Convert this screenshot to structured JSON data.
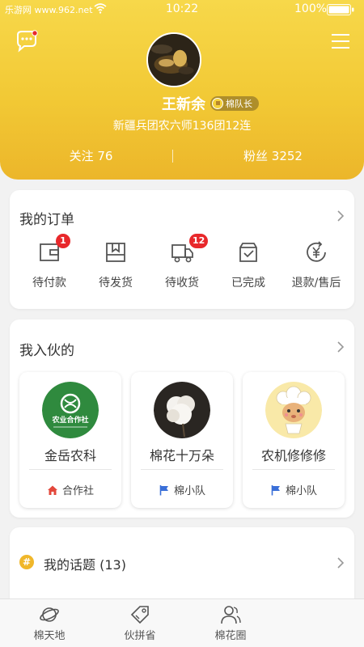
{
  "status_bar": {
    "carrier": "乐游网 www.962.net",
    "time": "10:22",
    "battery": "100%"
  },
  "profile": {
    "name": "王新余",
    "rank": "棉队长",
    "location": "新疆兵团农六师136团12连",
    "follow": "关注 76",
    "fans": "粉丝 3252"
  },
  "orders": {
    "title": "我的订单",
    "items": [
      {
        "label": "待付款",
        "icon": "wallet-icon",
        "badge": "1"
      },
      {
        "label": "待发货",
        "icon": "package-icon",
        "badge": ""
      },
      {
        "label": "待收货",
        "icon": "truck-icon",
        "badge": "12"
      },
      {
        "label": "已完成",
        "icon": "box-check-icon",
        "badge": ""
      },
      {
        "label": "退款/售后",
        "icon": "yen-refund-icon",
        "badge": ""
      }
    ]
  },
  "joined": {
    "title": "我入伙的",
    "groups": [
      {
        "name": "金岳农科",
        "tag": "合作社",
        "tag_icon": "house-icon",
        "logo_text": "农业合作社"
      },
      {
        "name": "棉花十万朵",
        "tag": "棉小队",
        "tag_icon": "flag-icon"
      },
      {
        "name": "农机修修修",
        "tag": "棉小队",
        "tag_icon": "flag-icon"
      }
    ]
  },
  "topics": {
    "label": "我的话题 (13)"
  },
  "tabbar": {
    "items": [
      {
        "label": "棉天地",
        "icon": "planet-icon"
      },
      {
        "label": "伙拼省",
        "icon": "tag-icon"
      },
      {
        "label": "棉花圈",
        "icon": "people-icon"
      }
    ]
  },
  "colors": {
    "header_yellow": "#f2c935",
    "badge_red": "#e8282b",
    "flag_blue": "#3a6fd8",
    "house_red": "#e3483c"
  }
}
